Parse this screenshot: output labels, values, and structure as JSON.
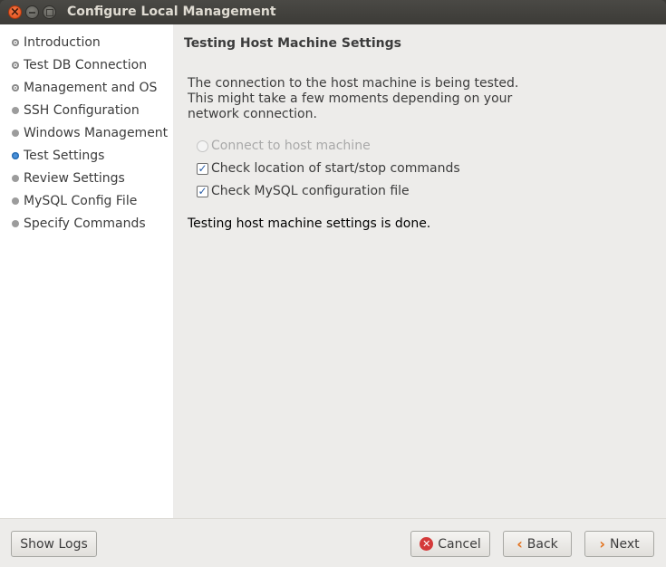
{
  "window": {
    "title": "Configure Local Management"
  },
  "sidebar": {
    "items": [
      {
        "label": "Introduction",
        "state": "done"
      },
      {
        "label": "Test DB Connection",
        "state": "done"
      },
      {
        "label": "Management and OS",
        "state": "done"
      },
      {
        "label": "SSH Configuration",
        "state": "todo"
      },
      {
        "label": "Windows Management",
        "state": "todo"
      },
      {
        "label": "Test Settings",
        "state": "active"
      },
      {
        "label": "Review Settings",
        "state": "todo"
      },
      {
        "label": "MySQL Config File",
        "state": "todo"
      },
      {
        "label": "Specify Commands",
        "state": "todo"
      }
    ]
  },
  "main": {
    "heading": "Testing Host Machine Settings",
    "description": "The connection to the host machine is being tested. This might take a few moments depending on your network connection.",
    "tasks": [
      {
        "label": "Connect to host machine",
        "state": "pending"
      },
      {
        "label": "Check location of start/stop commands",
        "state": "checked"
      },
      {
        "label": "Check MySQL configuration file",
        "state": "checked"
      }
    ],
    "status": "Testing host machine settings is done."
  },
  "buttons": {
    "show_logs": "Show Logs",
    "cancel": "Cancel",
    "back": "Back",
    "next": "Next"
  },
  "icons": {
    "close": "close-icon",
    "minimize": "minimize-icon",
    "maximize": "maximize-icon",
    "cancel": "cancel-icon",
    "back": "chevron-left-icon",
    "next": "chevron-right-icon"
  },
  "colors": {
    "active_step": "#4a90d9",
    "close_button": "#df4a16",
    "arrow": "#e3701a",
    "cancel_icon": "#d43a3a"
  }
}
